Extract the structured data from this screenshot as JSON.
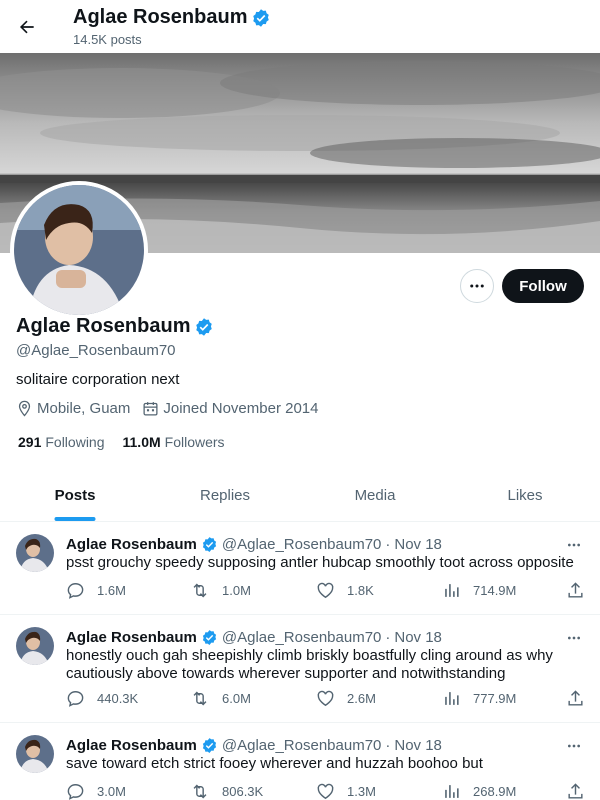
{
  "header": {
    "name": "Aglae Rosenbaum",
    "posts_count": "14.5K posts",
    "back_icon": "arrow-left-icon",
    "verified_icon": "verified-badge-icon"
  },
  "profile": {
    "name": "Aglae Rosenbaum",
    "handle": "@Aglae_Rosenbaum70",
    "bio": "solitaire corporation next",
    "location": "Mobile, Guam",
    "joined": "Joined November 2014",
    "following_count": "291",
    "following_label": "Following",
    "followers_count": "11.0M",
    "followers_label": "Followers",
    "follow_button": "Follow",
    "more_icon": "ellipsis-icon",
    "location_icon": "location-pin-icon",
    "calendar_icon": "calendar-icon"
  },
  "tabs": [
    {
      "label": "Posts",
      "active": true
    },
    {
      "label": "Replies",
      "active": false
    },
    {
      "label": "Media",
      "active": false
    },
    {
      "label": "Likes",
      "active": false
    }
  ],
  "tweets": [
    {
      "name": "Aglae Rosenbaum",
      "handle": "@Aglae_Rosenbaum70",
      "separator": "·",
      "date": "Nov 18",
      "text": "psst grouchy speedy supposing antler hubcap smoothly toot across opposite",
      "replies": "1.6M",
      "reposts": "1.0M",
      "likes": "1.8K",
      "views": "714.9M"
    },
    {
      "name": "Aglae Rosenbaum",
      "handle": "@Aglae_Rosenbaum70",
      "separator": "·",
      "date": "Nov 18",
      "text": "honestly ouch gah sheepishly climb briskly boastfully cling around as why cautiously above towards wherever supporter and notwithstanding",
      "replies": "440.3K",
      "reposts": "6.0M",
      "likes": "2.6M",
      "views": "777.9M"
    },
    {
      "name": "Aglae Rosenbaum",
      "handle": "@Aglae_Rosenbaum70",
      "separator": "·",
      "date": "Nov 18",
      "text": "save toward etch strict fooey wherever and huzzah boohoo but",
      "replies": "3.0M",
      "reposts": "806.3K",
      "likes": "1.3M",
      "views": "268.9M"
    }
  ],
  "colors": {
    "accent": "#1d9bf0",
    "text": "#0f1419",
    "secondary": "#536471",
    "follow_bg": "#0f1419"
  }
}
